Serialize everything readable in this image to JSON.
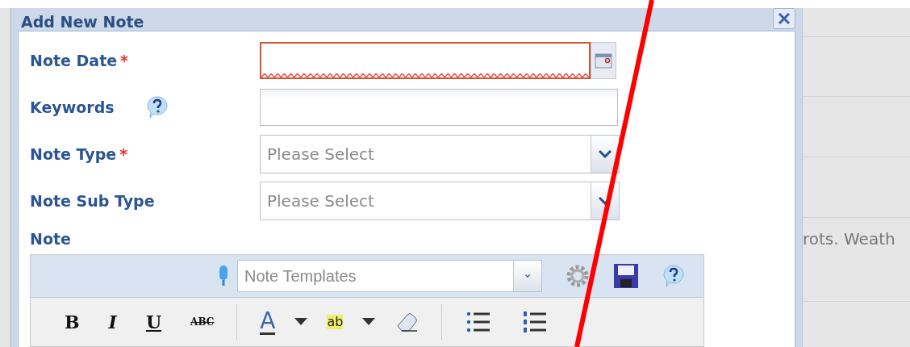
{
  "dialog": {
    "title": "Add New Note",
    "fields": [
      {
        "label": "Note Date",
        "required_mark": "*",
        "kind": "date",
        "invalid": true,
        "help": false
      },
      {
        "label": "Keywords",
        "kind": "text",
        "invalid": false,
        "help": true
      },
      {
        "label": "Note Type",
        "required_mark": "*",
        "kind": "select",
        "placeholder": "Please Select",
        "invalid": false,
        "help": false
      },
      {
        "label": "Note Sub Type",
        "kind": "select",
        "placeholder": "Please Select",
        "invalid": false,
        "help": false
      }
    ],
    "note_label": "Note",
    "editor": {
      "templates_placeholder": "Note Templates",
      "format_buttons": [
        {
          "kind": "bold",
          "label": "B"
        },
        {
          "kind": "italic",
          "label": "I"
        },
        {
          "kind": "underline",
          "label": "U"
        },
        {
          "kind": "strike",
          "label": "ABC"
        },
        {
          "kind": "separator"
        },
        {
          "kind": "font-color",
          "label": "A"
        },
        {
          "kind": "caret"
        },
        {
          "kind": "highlight",
          "label": "ab"
        },
        {
          "kind": "caret"
        },
        {
          "kind": "eraser"
        },
        {
          "kind": "separator"
        },
        {
          "kind": "bullets"
        },
        {
          "kind": "numbers"
        }
      ]
    }
  },
  "background": {
    "row_text": "rots.  Weath"
  }
}
